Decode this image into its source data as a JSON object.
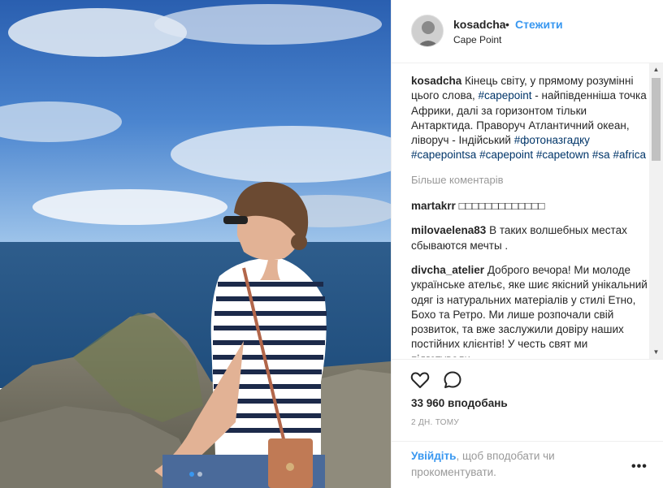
{
  "post": {
    "username": "kosadcha",
    "bullet": "•",
    "follow_label": "Стежити",
    "location": "Cape Point",
    "caption_text": "Кінець світу, у прямому розумінні цього слова, ",
    "caption_tag1": "#capepoint",
    "caption_text2": " - найпівденніша точка Африки, далі за горизонтом тільки Антарктида. Праворуч Атлантичний океан, ліворуч - Індійський ",
    "caption_tags": "#фотоназгадку #capepointsa #capepoint #capetown #sa #africa",
    "more_comments": "Більше коментарів",
    "comments": [
      {
        "user": "martakrr",
        "text": "□□□□□□□□□□□□□"
      },
      {
        "user": "milovaelena83",
        "text": "В таких волшебных местах сбываются мечты ."
      },
      {
        "user": "divcha_atelier",
        "text": "Доброго вечора! Ми молоде українське ательє, яке шиє якісний унікальний одяг із натуральних матеріалів у стилі Етно, Бохо та Ретро. Ми лише розпочали свій розвиток, та вже заслужили довіру наших постійних клієнтів! У честь свят ми підготували"
      }
    ],
    "likes": "33 960 вподобань",
    "time": "2 ДН. ТОМУ",
    "login_link": "Увійдіть",
    "login_rest": ", щоб вподобати чи прокоментувати.",
    "menu": "•••"
  },
  "icons": {
    "like": "heart-icon",
    "comment": "comment-bubble-icon",
    "more": "more-options-icon",
    "scroll_up": "▲",
    "scroll_down": "▼"
  },
  "colors": {
    "link": "#3897f0",
    "hashtag": "#003569",
    "muted": "#999999",
    "carousel_active": "#3897f0"
  },
  "carousel": {
    "total": 2,
    "current": 1
  }
}
